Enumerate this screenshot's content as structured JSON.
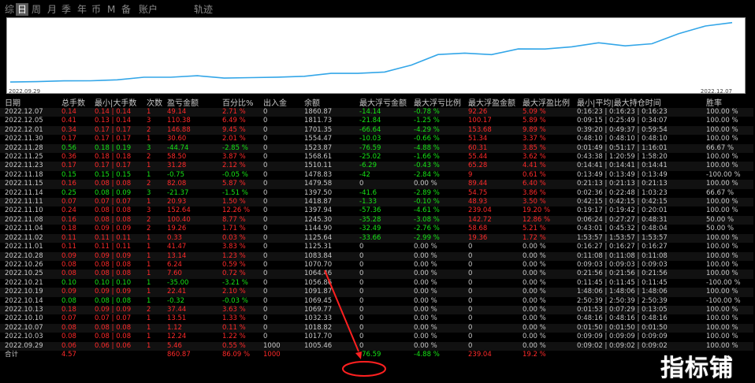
{
  "tabs": [
    "综",
    "日",
    "周",
    "月",
    "季",
    "年",
    "币",
    "M",
    "备",
    "账户",
    "轨迹"
  ],
  "active_tab": 1,
  "chart": {
    "start_date": "2022.09.29",
    "end_date": "2022.12.07",
    "line_color": "#33a6e8",
    "equity": [
      1000,
      1005.46,
      1017.7,
      1018.82,
      1032.33,
      1069.77,
      1069.45,
      1091.87,
      1056.86,
      1064.46,
      1070.7,
      1083.84,
      1125.31,
      1125.64,
      1144.9,
      1245.3,
      1397.94,
      1418.87,
      1397.5,
      1479.58,
      1478.83,
      1510.11,
      1568.61,
      1523.87,
      1554.47,
      1701.35,
      1811.73,
      1860.87
    ]
  },
  "headers": [
    "日期",
    "总手数",
    "最小|大手数",
    "次数",
    "盈亏金额",
    "百分比%",
    "出入金",
    "余额",
    "最大浮亏金额",
    "最大浮亏比例",
    "最大浮盈金额",
    "最大浮盈比例",
    "最小|平均|最大持仓时间",
    "胜率"
  ],
  "rows": [
    [
      "2022.12.07",
      "0.14",
      "0.14 | 0.14",
      "1",
      "49.14",
      "2.71 %",
      "0",
      "1860.87",
      "-14.14",
      "-0.78 %",
      "92.26",
      "5.09 %",
      "0:16:23 | 0:16:23 | 0:16:23",
      "100.00 %"
    ],
    [
      "2022.12.05",
      "0.41",
      "0.13 | 0.14",
      "3",
      "110.38",
      "6.49 %",
      "0",
      "1811.73",
      "-21.84",
      "-1.25 %",
      "100.17",
      "5.89 %",
      "0:09:15 | 0:25:49 | 0:34:07",
      "100.00 %"
    ],
    [
      "2022.12.01",
      "0.34",
      "0.17 | 0.17",
      "2",
      "146.88",
      "9.45 %",
      "0",
      "1701.35",
      "-66.64",
      "-4.29 %",
      "153.68",
      "9.89 %",
      "0:39:20 | 0:49:37 | 0:59:54",
      "100.00 %"
    ],
    [
      "2022.11.30",
      "0.17",
      "0.17 | 0.17",
      "1",
      "30.60",
      "2.01 %",
      "0",
      "1554.47",
      "-10.03",
      "-0.66 %",
      "51.34",
      "3.37 %",
      "0:48:10 | 0:48:10 | 0:48:10",
      "100.00 %"
    ],
    [
      "2022.11.28",
      "0.56",
      "0.18 | 0.19",
      "3",
      "-44.74",
      "-2.85 %",
      "0",
      "1523.87",
      "-76.59",
      "-4.88 %",
      "60.31",
      "3.85 %",
      "0:01:49 | 0:51:17 | 1:16:01",
      "66.67 %"
    ],
    [
      "2022.11.25",
      "0.36",
      "0.18 | 0.18",
      "2",
      "58.50",
      "3.87 %",
      "0",
      "1568.61",
      "-25.02",
      "-1.66 %",
      "55.44",
      "3.62 %",
      "0:43:38 | 1:20:59 | 1:58:20",
      "100.00 %"
    ],
    [
      "2022.11.23",
      "0.17",
      "0.17 | 0.17",
      "1",
      "31.28",
      "2.12 %",
      "0",
      "1510.11",
      "-6.29",
      "-0.43 %",
      "65.28",
      "4.41 %",
      "0:14:41 | 0:14:41 | 0:14:41",
      "100.00 %"
    ],
    [
      "2022.11.18",
      "0.15",
      "0.15 | 0.15",
      "1",
      "-0.75",
      "-0.05 %",
      "0",
      "1478.83",
      "-42",
      "-2.84 %",
      "9",
      "0.61 %",
      "0:13:49 | 0:13:49 | 0:13:49",
      "-100.00 %"
    ],
    [
      "2022.11.15",
      "0.16",
      "0.08 | 0.08",
      "2",
      "82.08",
      "5.87 %",
      "0",
      "1479.58",
      "0",
      "0.00 %",
      "89.44",
      "6.40 %",
      "0:21:13 | 0:21:13 | 0:21:13",
      "100.00 %"
    ],
    [
      "2022.11.14",
      "0.25",
      "0.08 | 0.09",
      "3",
      "-21.37",
      "-1.51 %",
      "0",
      "1397.50",
      "-41.6",
      "-2.89 %",
      "54.75",
      "3.86 %",
      "0:02:36 | 0:22:48 | 1:03:23",
      "66.67 %"
    ],
    [
      "2022.11.11",
      "0.07",
      "0.07 | 0.07",
      "1",
      "20.93",
      "1.50 %",
      "0",
      "1418.87",
      "-1.33",
      "-0.10 %",
      "48.93",
      "3.50 %",
      "0:42:15 | 0:42:15 | 0:42:15",
      "100.00 %"
    ],
    [
      "2022.11.10",
      "0.24",
      "0.08 | 0.08",
      "3",
      "152.64",
      "12.26 %",
      "0",
      "1397.94",
      "-57.36",
      "-4.61 %",
      "239.04",
      "19.20 %",
      "0:19:17 | 0:19:42 | 0:20:01",
      "100.00 %"
    ],
    [
      "2022.11.08",
      "0.16",
      "0.08 | 0.08",
      "2",
      "100.40",
      "8.77 %",
      "0",
      "1245.30",
      "-35.28",
      "-3.08 %",
      "142.72",
      "12.86 %",
      "0:06:24 | 0:27:27 | 0:48:31",
      "50.00 %"
    ],
    [
      "2022.11.04",
      "0.18",
      "0.09 | 0.09",
      "2",
      "19.26",
      "1.71 %",
      "0",
      "1144.90",
      "-32.49",
      "-2.76 %",
      "58.68",
      "5.21 %",
      "0:43:01 | 0:45:32 | 0:48:04",
      "50.00 %"
    ],
    [
      "2022.11.02",
      "0.11",
      "0.11 | 0.11",
      "1",
      "0.33",
      "0.03 %",
      "0",
      "1125.64",
      "-33.66",
      "-2.99 %",
      "19.36",
      "1.72 %",
      "1:53:57 | 1:53:57 | 1:53:57",
      "100.00 %"
    ],
    [
      "2022.11.01",
      "0.11",
      "0.11 | 0.11",
      "1",
      "41.47",
      "3.83 %",
      "0",
      "1125.31",
      "0",
      "0.00 %",
      "0",
      "0.00 %",
      "0:16:27 | 0:16:27 | 0:16:27",
      "100.00 %"
    ],
    [
      "2022.10.28",
      "0.09",
      "0.09 | 0.09",
      "1",
      "13.14",
      "1.23 %",
      "0",
      "1083.84",
      "0",
      "0.00 %",
      "0",
      "0.00 %",
      "0:11:08 | 0:11:08 | 0:11:08",
      "100.00 %"
    ],
    [
      "2022.10.26",
      "0.08",
      "0.08 | 0.08",
      "1",
      "6.24",
      "0.59 %",
      "0",
      "1070.70",
      "0",
      "0.00 %",
      "0",
      "0.00 %",
      "0:09:03 | 0:09:03 | 0:09:03",
      "100.00 %"
    ],
    [
      "2022.10.25",
      "0.08",
      "0.08 | 0.08",
      "1",
      "7.60",
      "0.72 %",
      "0",
      "1064.46",
      "0",
      "0.00 %",
      "0",
      "0.00 %",
      "0:21:56 | 0:21:56 | 0:21:56",
      "100.00 %"
    ],
    [
      "2022.10.21",
      "0.10",
      "0.10 | 0.10",
      "1",
      "-35.00",
      "-3.21 %",
      "0",
      "1056.86",
      "0",
      "0.00 %",
      "0",
      "0.00 %",
      "0:11:45 | 0:11:45 | 0:11:45",
      "-100.00 %"
    ],
    [
      "2022.10.19",
      "0.09",
      "0.09 | 0.09",
      "1",
      "22.41",
      "2.10 %",
      "0",
      "1091.87",
      "0",
      "0.00 %",
      "0",
      "0.00 %",
      "1:48:06 | 1:48:06 | 1:48:06",
      "100.00 %"
    ],
    [
      "2022.10.14",
      "0.08",
      "0.08 | 0.08",
      "1",
      "-0.32",
      "-0.03 %",
      "0",
      "1069.45",
      "0",
      "0.00 %",
      "0",
      "0.00 %",
      "2:50:39 | 2:50:39 | 2:50:39",
      "-100.00 %"
    ],
    [
      "2022.10.13",
      "0.18",
      "0.09 | 0.09",
      "2",
      "37.44",
      "3.63 %",
      "0",
      "1069.77",
      "0",
      "0.00 %",
      "0",
      "0.00 %",
      "0:01:53 | 0:07:29 | 0:13:05",
      "100.00 %"
    ],
    [
      "2022.10.10",
      "0.07",
      "0.07 | 0.07",
      "1",
      "13.51",
      "1.33 %",
      "0",
      "1032.33",
      "0",
      "0.00 %",
      "0",
      "0.00 %",
      "0:48:16 | 0:48:16 | 0:48:16",
      "100.00 %"
    ],
    [
      "2022.10.07",
      "0.08",
      "0.08 | 0.08",
      "1",
      "1.12",
      "0.11 %",
      "0",
      "1018.82",
      "0",
      "0.00 %",
      "0",
      "0.00 %",
      "0:01:50 | 0:01:50 | 0:01:50",
      "100.00 %"
    ],
    [
      "2022.10.03",
      "0.08",
      "0.08 | 0.08",
      "1",
      "12.24",
      "1.22 %",
      "0",
      "1017.70",
      "0",
      "0.00 %",
      "0",
      "0.00 %",
      "0:09:09 | 0:09:09 | 0:09:09",
      "100.00 %"
    ],
    [
      "2022.09.29",
      "0.06",
      "0.06 | 0.06",
      "1",
      "5.46",
      "0.55 %",
      "1000",
      "1005.46",
      "0",
      "0.00 %",
      "0",
      "0.00 %",
      "0:09:02 | 0:09:02 | 0:09:02",
      "100.00 %"
    ]
  ],
  "total": [
    "合计",
    "4.57",
    "",
    "",
    "860.87",
    "86.09 %",
    "1000",
    "",
    "-76.59",
    "-4.88 %",
    "239.04",
    "19.2 %",
    "",
    ""
  ],
  "watermark": "指标铺",
  "colors": {
    "positive": "#ff2a2a",
    "negative": "#16e416",
    "neutral": "#c8c8c8",
    "annotation": "#ff2020"
  }
}
